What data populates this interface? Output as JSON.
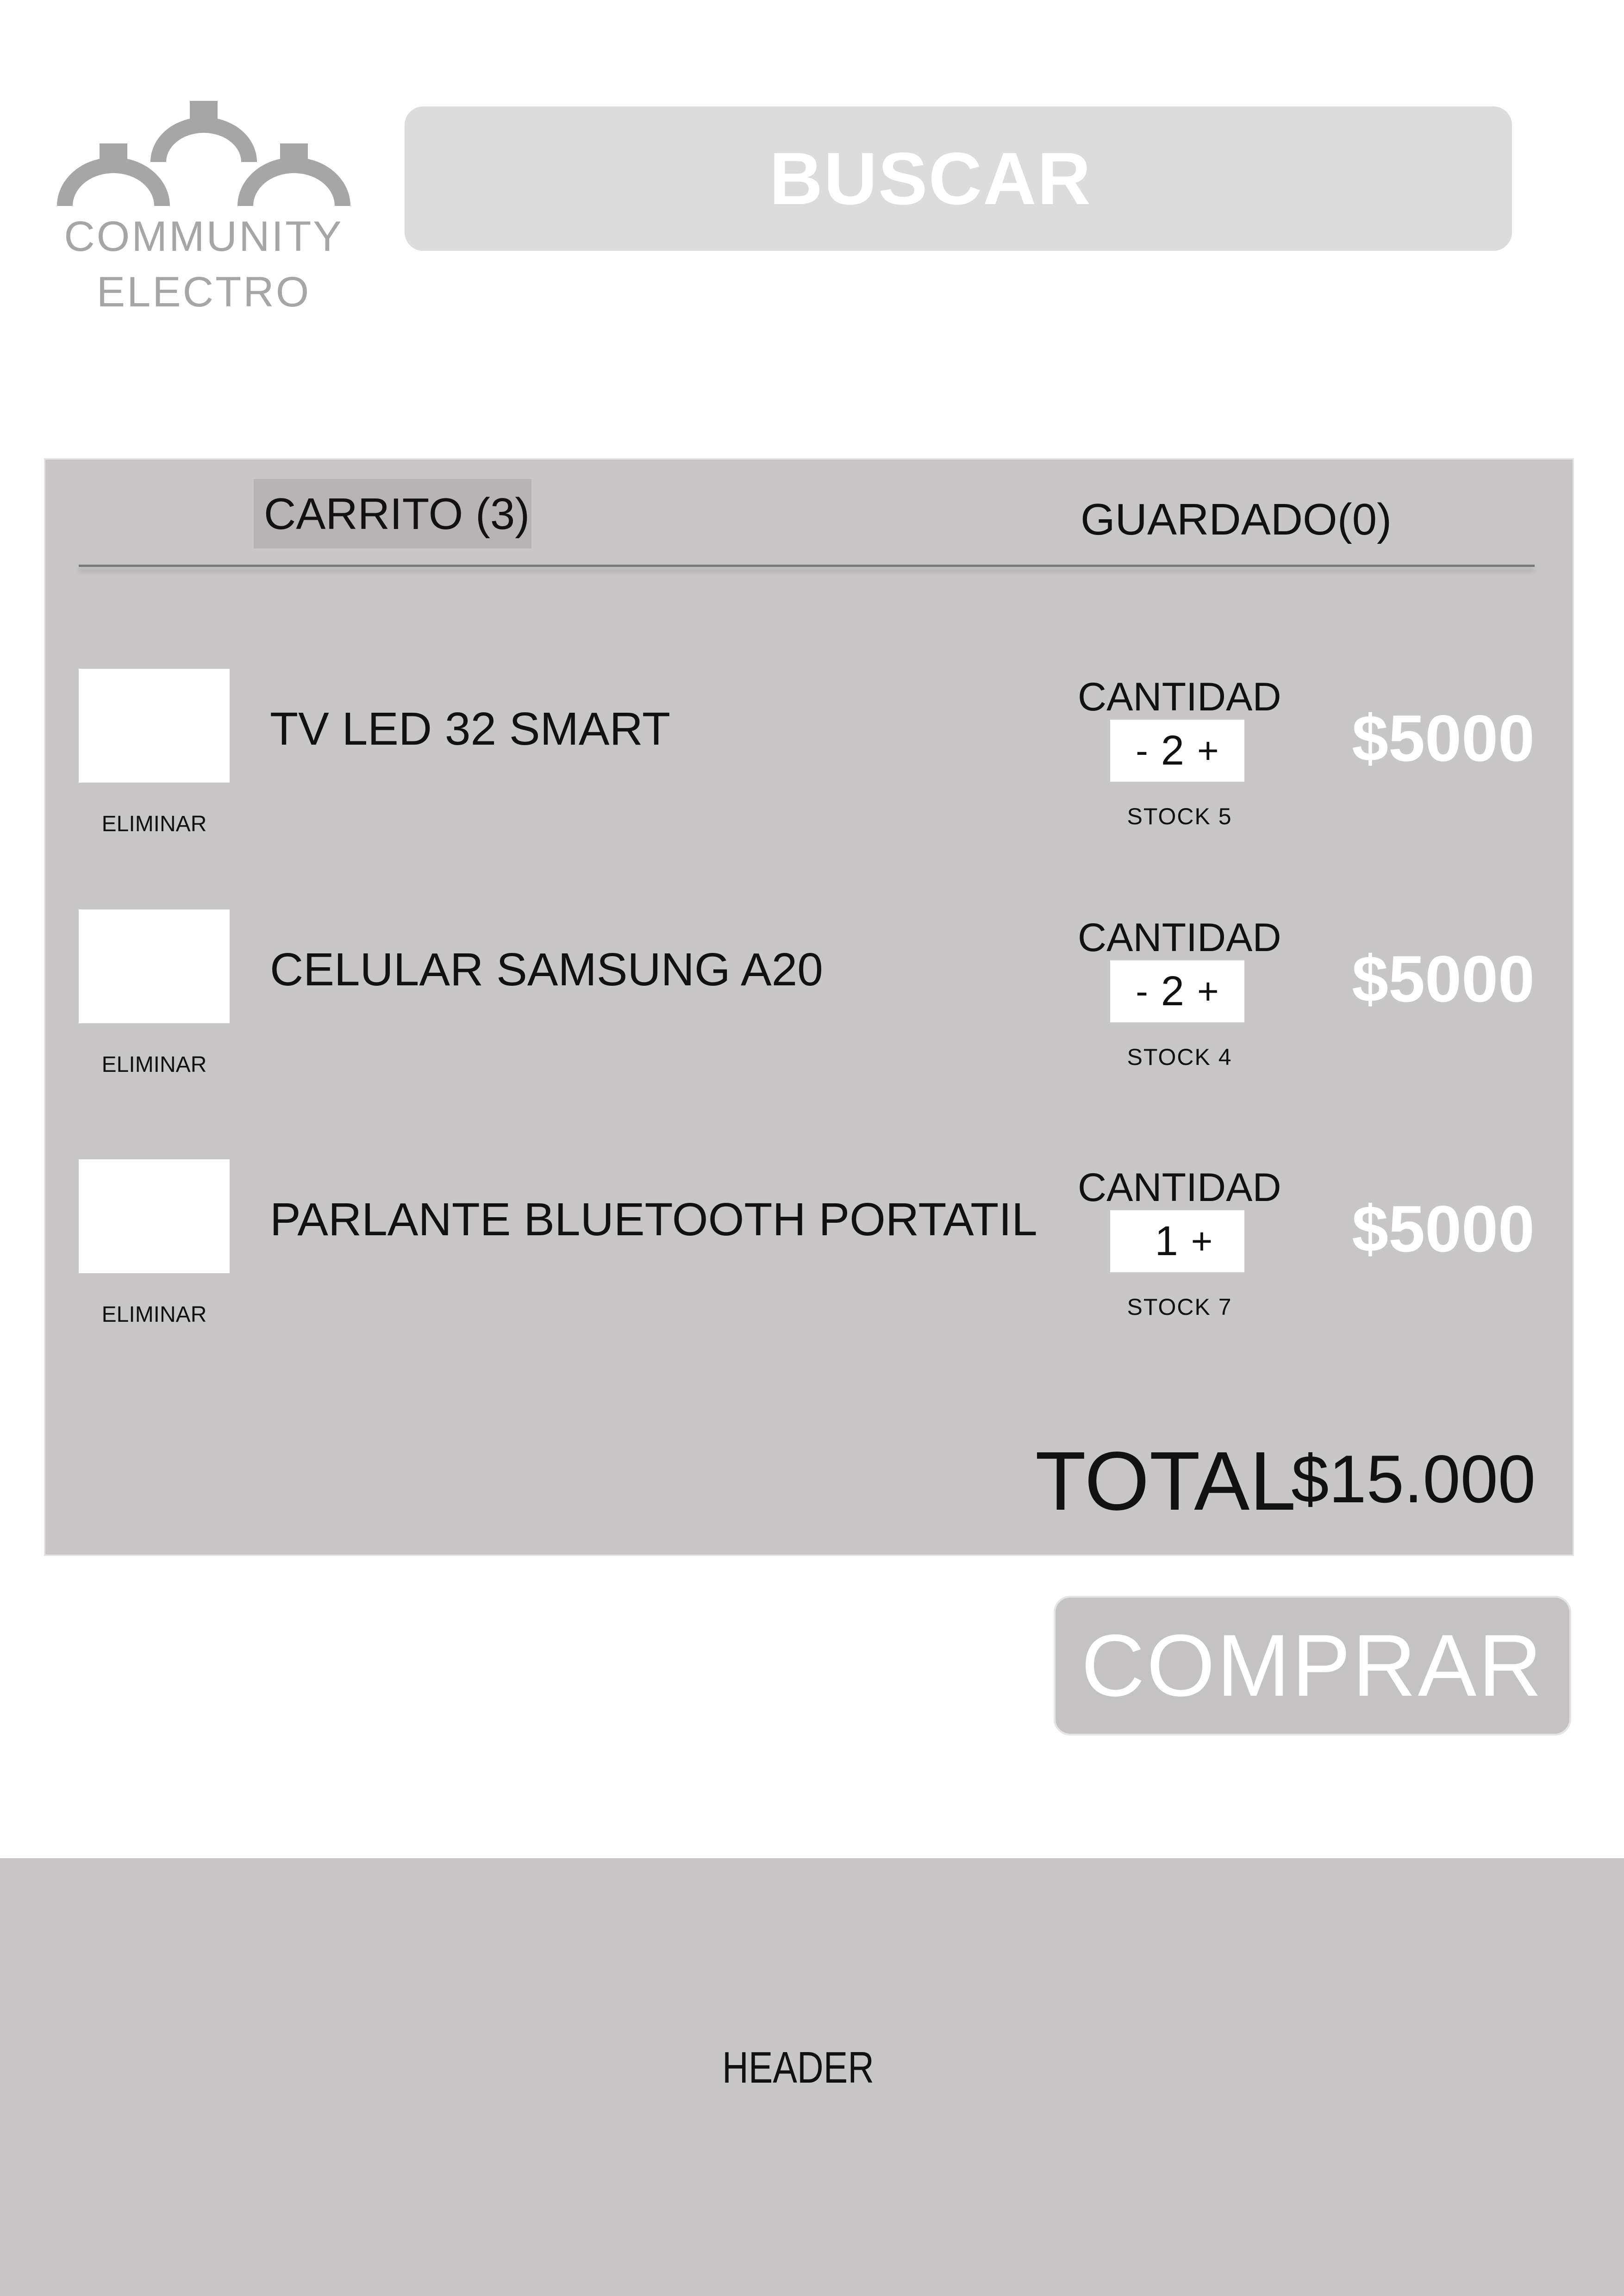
{
  "logo": {
    "line1": "COMMUNITY",
    "line2": "ELECTRO",
    "icon": "three-lamps-icon"
  },
  "search": {
    "label": "BUSCAR"
  },
  "cart": {
    "tabs": {
      "cart": "CARRITO (3)",
      "saved": "GUARDADO(0)"
    },
    "items": [
      {
        "name": "TV LED 32 SMART",
        "remove_label": "ELIMINAR",
        "qty_label": "CANTIDAD",
        "minus": "-",
        "quantity": "2",
        "plus": "+",
        "stock": "STOCK  5",
        "price": "$5000"
      },
      {
        "name": "CELULAR SAMSUNG A20",
        "remove_label": "ELIMINAR",
        "qty_label": "CANTIDAD",
        "minus": "-",
        "quantity": "2",
        "plus": "+",
        "stock": "STOCK  4",
        "price": "$5000"
      },
      {
        "name": "PARLANTE BLUETOOTH PORTATIL",
        "remove_label": "ELIMINAR",
        "qty_label": "CANTIDAD",
        "minus": "",
        "quantity": "1",
        "plus": "+",
        "stock": "STOCK  7",
        "price": "$5000"
      }
    ],
    "total_label": "TOTAL",
    "total_value": "$15.000"
  },
  "actions": {
    "buy_label": "COMPRAR"
  },
  "footer": {
    "label": "HEADER"
  },
  "colors": {
    "panel": "#c9c6c7",
    "search": "#dcdcdc",
    "logo": "#a6a6a6"
  }
}
